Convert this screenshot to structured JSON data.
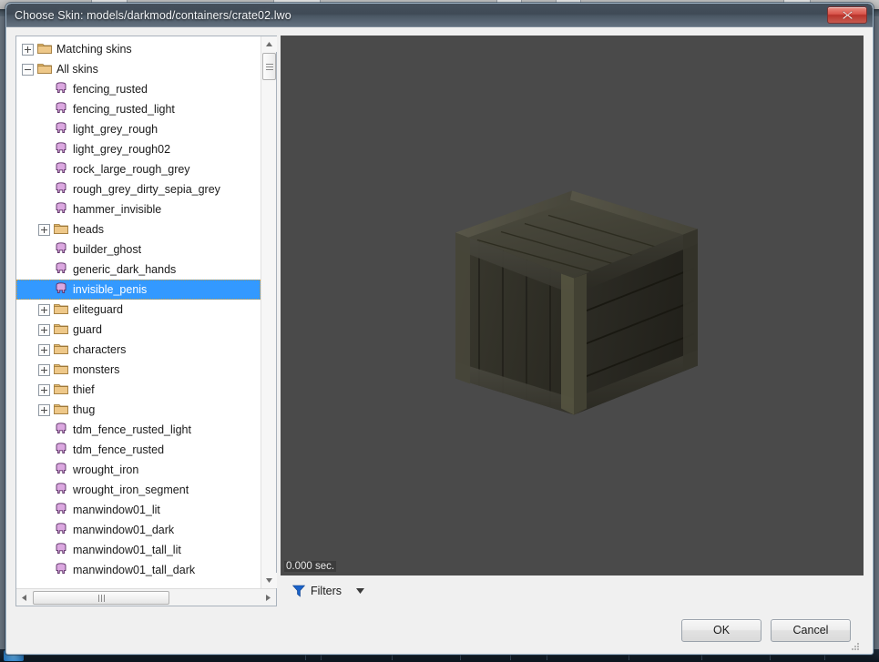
{
  "window": {
    "title": "Choose Skin: models/darkmod/containers/crate02.lwo",
    "close_icon": "close-icon"
  },
  "tree": {
    "items": [
      {
        "label": "Matching skins",
        "type": "folder",
        "expander": "plus",
        "depth": 0,
        "selected": false
      },
      {
        "label": "All skins",
        "type": "folder",
        "expander": "minus",
        "depth": 0,
        "selected": false
      },
      {
        "label": "fencing_rusted",
        "type": "skin",
        "expander": "none",
        "depth": 1,
        "selected": false
      },
      {
        "label": "fencing_rusted_light",
        "type": "skin",
        "expander": "none",
        "depth": 1,
        "selected": false
      },
      {
        "label": "light_grey_rough",
        "type": "skin",
        "expander": "none",
        "depth": 1,
        "selected": false
      },
      {
        "label": "light_grey_rough02",
        "type": "skin",
        "expander": "none",
        "depth": 1,
        "selected": false
      },
      {
        "label": "rock_large_rough_grey",
        "type": "skin",
        "expander": "none",
        "depth": 1,
        "selected": false
      },
      {
        "label": "rough_grey_dirty_sepia_grey",
        "type": "skin",
        "expander": "none",
        "depth": 1,
        "selected": false
      },
      {
        "label": "hammer_invisible",
        "type": "skin",
        "expander": "none",
        "depth": 1,
        "selected": false
      },
      {
        "label": "heads",
        "type": "folder",
        "expander": "plus",
        "depth": 1,
        "selected": false
      },
      {
        "label": "builder_ghost",
        "type": "skin",
        "expander": "none",
        "depth": 1,
        "selected": false
      },
      {
        "label": "generic_dark_hands",
        "type": "skin",
        "expander": "none",
        "depth": 1,
        "selected": false
      },
      {
        "label": "invisible_penis",
        "type": "skin",
        "expander": "none",
        "depth": 1,
        "selected": true
      },
      {
        "label": "eliteguard",
        "type": "folder",
        "expander": "plus",
        "depth": 1,
        "selected": false
      },
      {
        "label": "guard",
        "type": "folder",
        "expander": "plus",
        "depth": 1,
        "selected": false
      },
      {
        "label": "characters",
        "type": "folder",
        "expander": "plus",
        "depth": 1,
        "selected": false
      },
      {
        "label": "monsters",
        "type": "folder",
        "expander": "plus",
        "depth": 1,
        "selected": false
      },
      {
        "label": "thief",
        "type": "folder",
        "expander": "plus",
        "depth": 1,
        "selected": false
      },
      {
        "label": "thug",
        "type": "folder",
        "expander": "plus",
        "depth": 1,
        "selected": false
      },
      {
        "label": "tdm_fence_rusted_light",
        "type": "skin",
        "expander": "none",
        "depth": 1,
        "selected": false
      },
      {
        "label": "tdm_fence_rusted",
        "type": "skin",
        "expander": "none",
        "depth": 1,
        "selected": false
      },
      {
        "label": "wrought_iron",
        "type": "skin",
        "expander": "none",
        "depth": 1,
        "selected": false
      },
      {
        "label": "wrought_iron_segment",
        "type": "skin",
        "expander": "none",
        "depth": 1,
        "selected": false
      },
      {
        "label": "manwindow01_lit",
        "type": "skin",
        "expander": "none",
        "depth": 1,
        "selected": false
      },
      {
        "label": "manwindow01_dark",
        "type": "skin",
        "expander": "none",
        "depth": 1,
        "selected": false
      },
      {
        "label": "manwindow01_tall_lit",
        "type": "skin",
        "expander": "none",
        "depth": 1,
        "selected": false
      },
      {
        "label": "manwindow01_tall_dark",
        "type": "skin",
        "expander": "none",
        "depth": 1,
        "selected": false
      }
    ],
    "selection_color": "#3399ff",
    "folder_icon_color": "#e2b86b",
    "skin_icon_color": "#dba8e0",
    "vscroll": {
      "up_icon": "scroll-up-arrow-icon",
      "down_icon": "scroll-down-arrow-icon"
    },
    "hscroll": {
      "left_icon": "scroll-left-arrow-icon",
      "right_icon": "scroll-right-arrow-icon"
    }
  },
  "preview": {
    "perf_text": "0.000 sec.",
    "background_color": "#4a4a4a",
    "model_name": "crate"
  },
  "filters": {
    "label": "Filters",
    "icon": "funnel-filter-icon",
    "icon_color": "#1a62c8",
    "caret_icon": "chevron-down-icon"
  },
  "footer": {
    "ok_label": "OK",
    "cancel_label": "Cancel"
  }
}
